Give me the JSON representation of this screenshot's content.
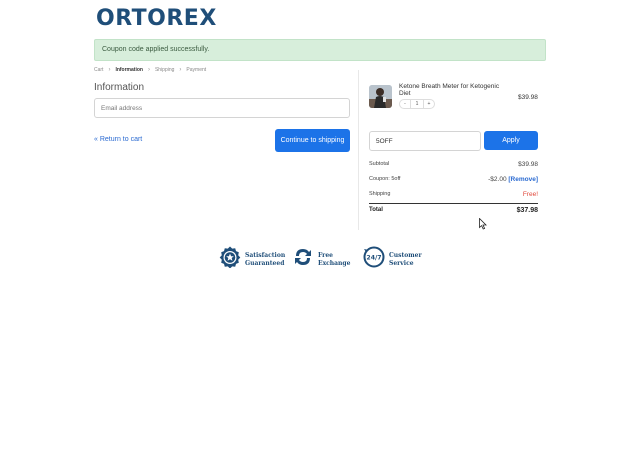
{
  "brand": {
    "logo_text": "ORTOREX",
    "color": "#1f4e79"
  },
  "notice": {
    "text": "Coupon code applied successfully."
  },
  "breadcrumb": {
    "items": [
      "Cart",
      "Information",
      "Shipping",
      "Payment"
    ],
    "current": "Information"
  },
  "information": {
    "title": "Information",
    "email_placeholder": "Email address",
    "email_value": ""
  },
  "actions": {
    "return_label": "« Return to cart",
    "continue_label": "Continue to shipping"
  },
  "product": {
    "name": "Ketone Breath Meter for Ketogenic Diet",
    "quantity": "1",
    "minus": "-",
    "plus": "+",
    "price": "$39.98"
  },
  "coupon": {
    "value": "5OFF",
    "apply_label": "Apply"
  },
  "summary": {
    "subtotal_label": "Subtotal",
    "subtotal_value": "$39.98",
    "coupon_label": "Coupon: 5off",
    "coupon_value": "-$2.00",
    "remove_label": "[Remove]",
    "shipping_label": "Shipping",
    "shipping_value": "Free!",
    "total_label": "Total",
    "total_value": "$37.98"
  },
  "badges": [
    {
      "icon": "star-seal-icon",
      "line1": "Satisfaction",
      "line2": "Guaranteed"
    },
    {
      "icon": "exchange-arrows-icon",
      "line1": "Free",
      "line2": "Exchange"
    },
    {
      "icon": "24-7-support-icon",
      "line1": "Customer",
      "line2": "Service",
      "glyph": "24/7"
    }
  ],
  "colors": {
    "accent": "#1c73e8",
    "success_bg": "#d7eedb",
    "free": "#e0473a"
  }
}
